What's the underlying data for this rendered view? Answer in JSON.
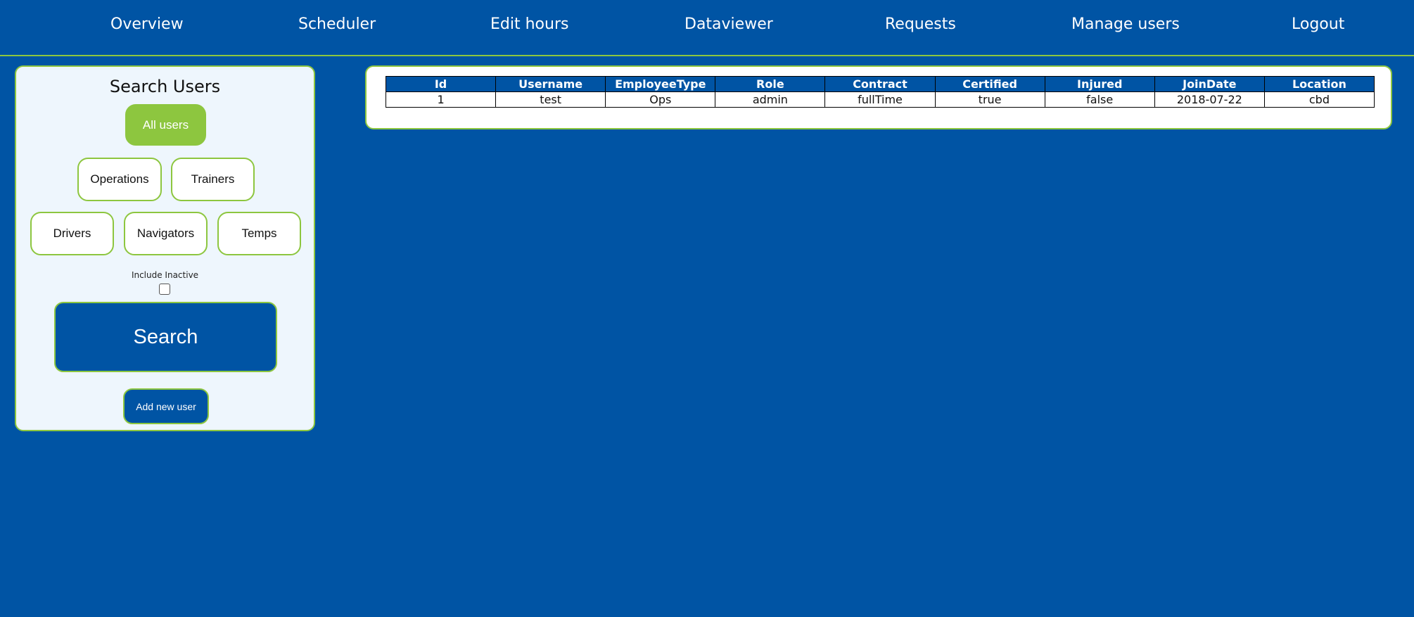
{
  "nav": {
    "items": [
      {
        "label": "Overview"
      },
      {
        "label": "Scheduler"
      },
      {
        "label": "Edit hours"
      },
      {
        "label": "Dataviewer"
      },
      {
        "label": "Requests"
      },
      {
        "label": "Manage users"
      },
      {
        "label": "Logout"
      }
    ]
  },
  "search": {
    "title": "Search Users",
    "filters": {
      "all_users": "All users",
      "operations": "Operations",
      "trainers": "Trainers",
      "drivers": "Drivers",
      "navigators": "Navigators",
      "temps": "Temps"
    },
    "active_filter": "All users",
    "include_inactive_label": "Include Inactive",
    "include_inactive_checked": false,
    "search_label": "Search",
    "add_user_label": "Add new user"
  },
  "table": {
    "columns": [
      "Id",
      "Username",
      "EmployeeType",
      "Role",
      "Contract",
      "Certified",
      "Injured",
      "JoinDate",
      "Location"
    ],
    "rows": [
      [
        "1",
        "test",
        "Ops",
        "admin",
        "fullTime",
        "true",
        "false",
        "2018-07-22",
        "cbd"
      ]
    ]
  },
  "colors": {
    "brand_blue": "#0054a4",
    "accent_green": "#8dc63f",
    "panel_bg": "#eef6fd"
  }
}
